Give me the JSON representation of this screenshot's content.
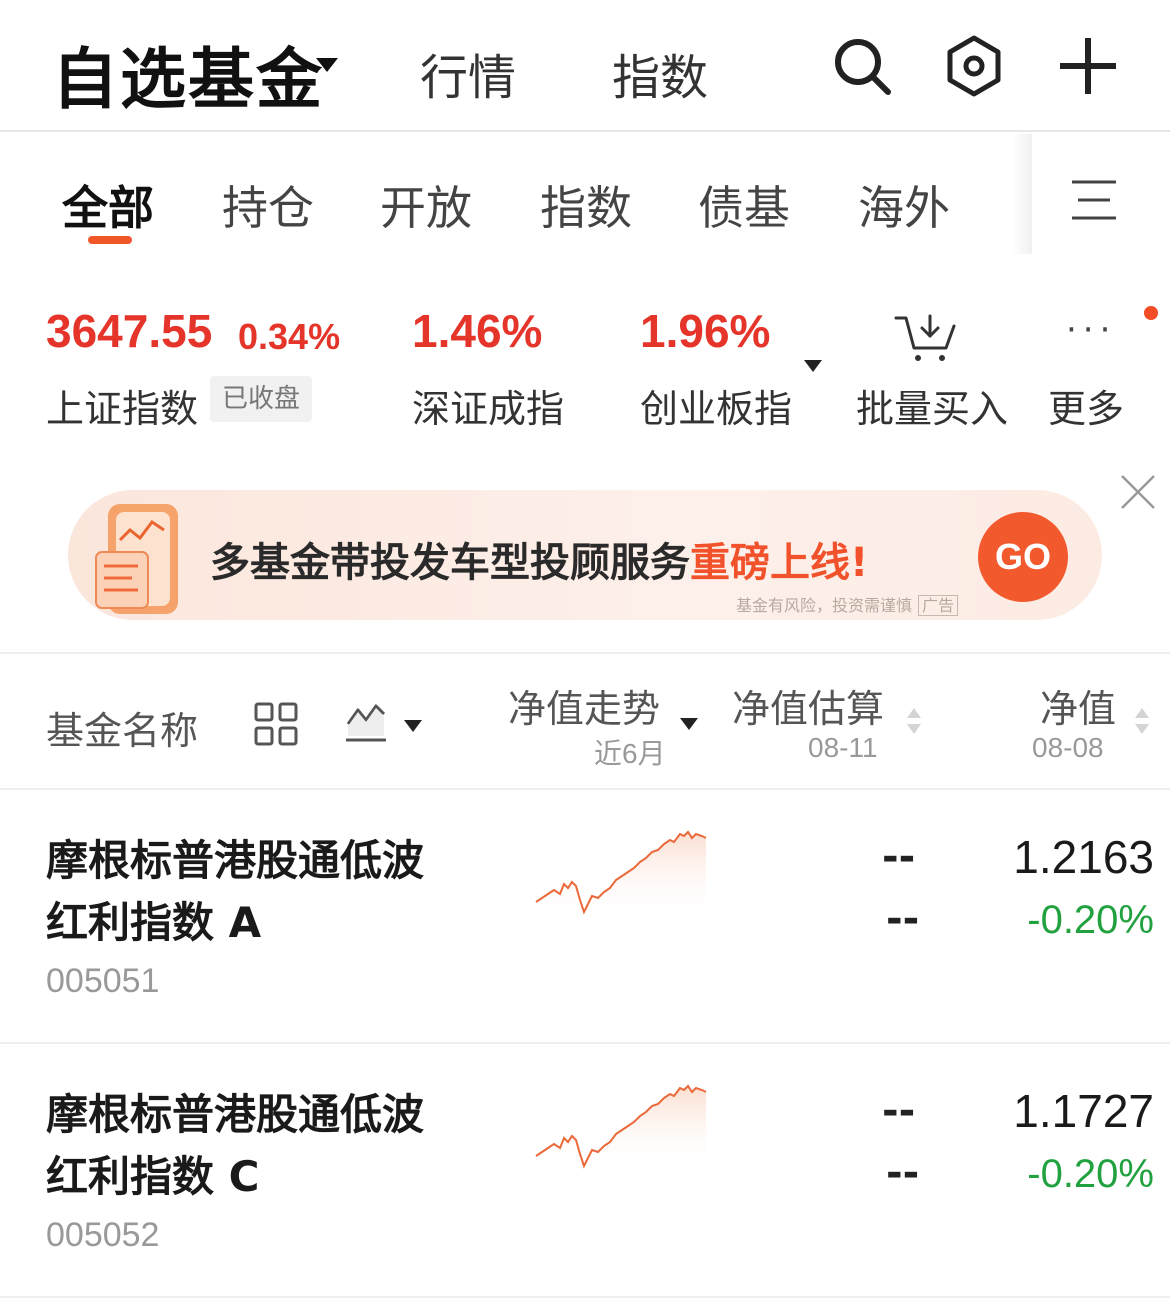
{
  "header": {
    "title": "自选基金",
    "nav": [
      "行情",
      "指数"
    ],
    "icons": [
      "search-icon",
      "settings-icon",
      "plus-icon"
    ]
  },
  "tabs": {
    "items": [
      "全部",
      "持仓",
      "开放",
      "指数",
      "债基",
      "海外"
    ],
    "active": "全部",
    "accent_color": "#f2572a"
  },
  "indices": {
    "sh": {
      "value": "3647.55",
      "change": "0.34%",
      "name": "上证指数",
      "badge": "已收盘"
    },
    "sz": {
      "change": "1.46%",
      "name": "深证成指"
    },
    "cy": {
      "change": "1.96%",
      "name": "创业板指"
    },
    "tools": {
      "batch_buy": "批量买入",
      "more": "更多"
    },
    "up_color": "#e5342a"
  },
  "banner": {
    "text_main": "多基金带投发车型投顾服务",
    "text_highlight": "重磅上线!",
    "go": "GO",
    "note": "基金有风险，投资需谨慎",
    "ad": "广告"
  },
  "columns": {
    "name": "基金名称",
    "trend": {
      "title": "净值走势",
      "sub": "近6月"
    },
    "estimate": {
      "title": "净值估算",
      "sub": "08-11"
    },
    "nav": {
      "title": "净值",
      "sub": "08-08"
    }
  },
  "funds": [
    {
      "name_line1": "摩根标普港股通低波",
      "name_line2": "红利指数 A",
      "code": "005051",
      "est_value": "--",
      "est_change": "--",
      "nav": "1.2163",
      "change": "-0.20%"
    },
    {
      "name_line1": "摩根标普港股通低波",
      "name_line2": "红利指数 C",
      "code": "005052",
      "est_value": "--",
      "est_change": "--",
      "nav": "1.1727",
      "change": "-0.20%"
    }
  ],
  "down_color": "#22a140"
}
